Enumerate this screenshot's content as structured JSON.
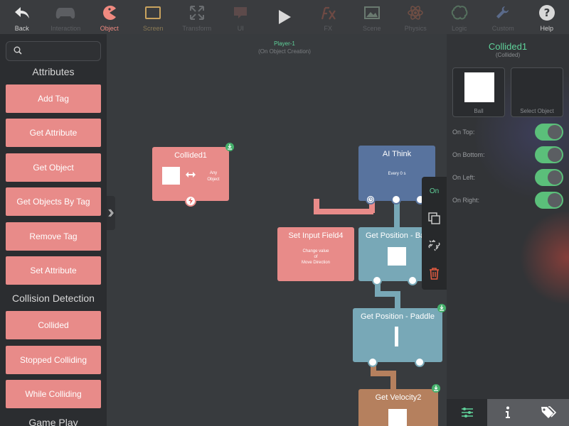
{
  "toolbar": {
    "items": [
      {
        "label": "Back",
        "icon": "back-arrow-icon"
      },
      {
        "label": "Interaction",
        "icon": "gamepad-icon"
      },
      {
        "label": "Object",
        "icon": "pacman-icon"
      },
      {
        "label": "Screen",
        "icon": "screen-icon"
      },
      {
        "label": "Transform",
        "icon": "transform-icon"
      },
      {
        "label": "UI",
        "icon": "chat-bubble-icon"
      },
      {
        "label": "",
        "icon": "play-icon"
      },
      {
        "label": "FX",
        "icon": "fx-icon"
      },
      {
        "label": "Scene",
        "icon": "picture-icon"
      },
      {
        "label": "Physics",
        "icon": "atom-icon"
      },
      {
        "label": "Logic",
        "icon": "brain-icon"
      },
      {
        "label": "Custom",
        "icon": "wrench-icon"
      },
      {
        "label": "Help",
        "icon": "question-icon"
      }
    ]
  },
  "sidebar": {
    "search_placeholder": "",
    "section_attributes": "Attributes",
    "attributes": [
      "Add Tag",
      "Get Attribute",
      "Get Object",
      "Get Objects By Tag",
      "Remove Tag",
      "Set Attribute"
    ],
    "section_collision": "Collision Detection",
    "collision": [
      "Collided",
      "Stopped Colliding",
      "While Colliding"
    ],
    "section_gameplay": "Game Play"
  },
  "canvas": {
    "title": "Player-1",
    "subtitle": "(On Object Creation)",
    "nodes": {
      "collided": {
        "title": "Collided1",
        "target": "Any Object"
      },
      "ai_think": {
        "title": "AI Think",
        "sub": "Every 0 s"
      },
      "set_input": {
        "title": "Set Input Field4",
        "sub1": "Change  value",
        "sub2": "of",
        "sub3": "Move Direction"
      },
      "get_pos_ball": {
        "title": "Get Position - Ba"
      },
      "get_pos_paddle": {
        "title": "Get Position - Paddle"
      },
      "get_velocity": {
        "title": "Get Velocity2"
      }
    }
  },
  "context_menu": {
    "on_label": "On"
  },
  "right_panel": {
    "title": "Collided1",
    "subtitle": "(Collided)",
    "object_a": "Ball",
    "object_b": "Select Object",
    "toggles": [
      {
        "label": "On Top:",
        "value": true
      },
      {
        "label": "On Bottom:",
        "value": true
      },
      {
        "label": "On Left:",
        "value": true
      },
      {
        "label": "On Right:",
        "value": true
      }
    ]
  },
  "colors": {
    "accent_green": "#5fd29a",
    "node_pink": "#e88b89",
    "node_blue": "#58739e",
    "node_teal": "#78a8b7",
    "node_brown": "#b5805e",
    "toggle_green": "#5bbf7a"
  }
}
